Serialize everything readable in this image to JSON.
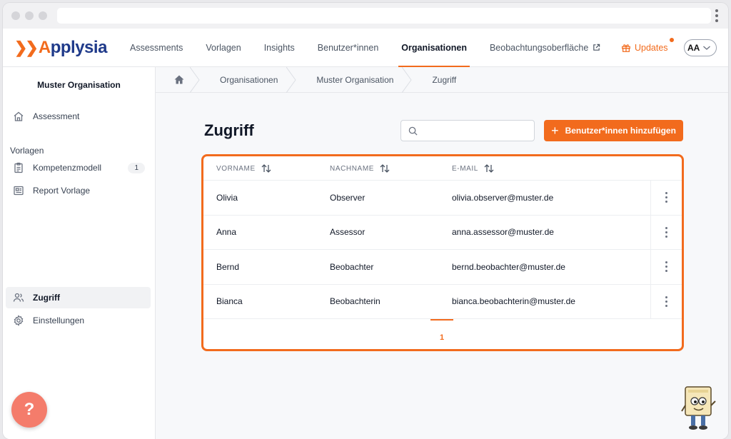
{
  "nav": {
    "logo": "Applysia",
    "items": [
      {
        "label": "Assessments"
      },
      {
        "label": "Vorlagen"
      },
      {
        "label": "Insights"
      },
      {
        "label": "Benutzer*innen"
      },
      {
        "label": "Organisationen"
      },
      {
        "label": "Beobachtungsoberfläche"
      }
    ],
    "updates": "Updates",
    "avatar": "AA"
  },
  "sidebar": {
    "org_name": "Muster Organisation",
    "assessment": "Assessment",
    "vorlagen_heading": "Vorlagen",
    "kompetenzmodell": "Kompetenzmodell",
    "kompetenzmodell_count": "1",
    "report_vorlage": "Report Vorlage",
    "zugriff": "Zugriff",
    "einstellungen": "Einstellungen"
  },
  "breadcrumb": {
    "items": [
      "Organisationen",
      "Muster Organisation",
      "Zugriff"
    ]
  },
  "page": {
    "title": "Zugriff",
    "search_placeholder": "",
    "add_button": "Benutzer*innen hinzufügen"
  },
  "table": {
    "headers": [
      "VORNAME",
      "NACHNAME",
      "E-MAIL"
    ],
    "rows": [
      {
        "vorname": "Olivia",
        "nachname": "Observer",
        "email": "olivia.observer@muster.de"
      },
      {
        "vorname": "Anna",
        "nachname": "Assessor",
        "email": "anna.assessor@muster.de"
      },
      {
        "vorname": "Bernd",
        "nachname": "Beobachter",
        "email": "bernd.beobachter@muster.de"
      },
      {
        "vorname": "Bianca",
        "nachname": "Beobachterin",
        "email": "bianca.beobachterin@muster.de"
      }
    ],
    "page": "1"
  },
  "help_label": "?",
  "colors": {
    "accent": "#f26b1d",
    "brand": "#1f3a8a",
    "help": "#f47c6b"
  }
}
